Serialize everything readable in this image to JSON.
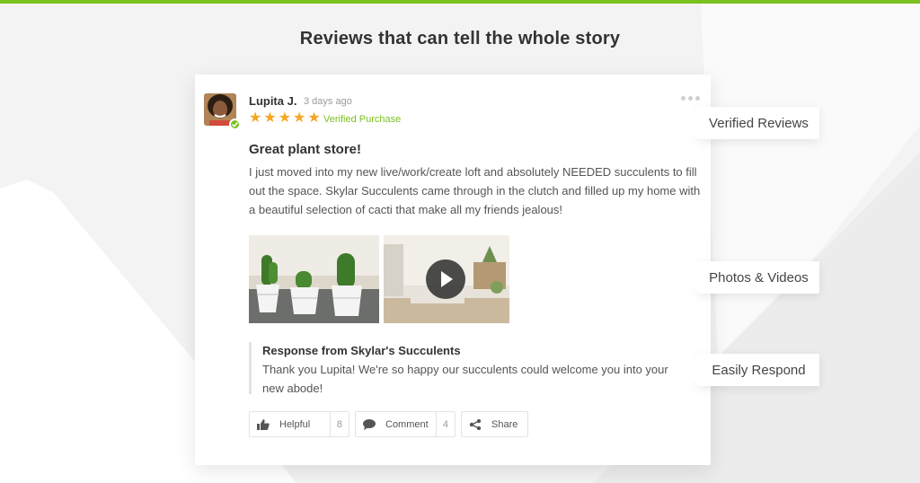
{
  "colors": {
    "accent_green": "#7bc11f",
    "star": "#f5a623",
    "background": "#f3f3f3"
  },
  "headline": "Reviews that can tell the whole story",
  "review": {
    "reviewer_name": "Lupita J.",
    "time_ago": "3 days ago",
    "rating": 5,
    "verified_label": "Verified Purchase",
    "title": "Great plant store!",
    "body": "I just moved into my new live/work/create loft and absolutely NEEDED succulents to fill out the space. Skylar Succulents came through in the clutch and filled up my home with a beautiful selection of cacti that make all my friends jealous!",
    "media": [
      {
        "kind": "photo",
        "subject": "potted cacti"
      },
      {
        "kind": "video",
        "subject": "loft interior"
      }
    ],
    "response": {
      "title": "Response from Skylar's Succulents",
      "text": "Thank you Lupita! We're so happy our succulents could welcome you into your new abode!"
    },
    "actions": {
      "helpful_label": "Helpful",
      "helpful_count": "8",
      "comment_label": "Comment",
      "comment_count": "4",
      "share_label": "Share"
    }
  },
  "callouts": {
    "verified": "Verified Reviews",
    "media": "Photos & Videos",
    "respond": "Easily Respond"
  },
  "icons": {
    "stars": "star-icon",
    "more": "ellipsis-icon",
    "helpful": "thumbs-up-icon",
    "comment": "speech-bubble-icon",
    "share": "share-icon",
    "play": "play-icon",
    "verified": "checkmark-badge-icon"
  }
}
